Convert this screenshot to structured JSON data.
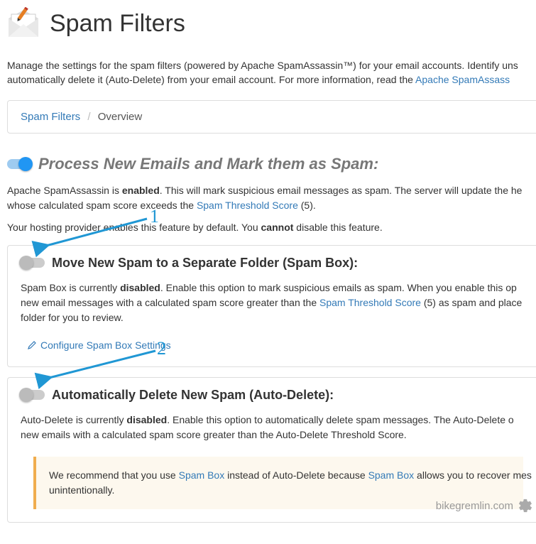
{
  "header": {
    "title": "Spam Filters"
  },
  "intro": {
    "text_a": "Manage the settings for the spam filters (powered by Apache SpamAssassin™) for your email accounts. Identify uns",
    "text_b": "automatically delete it (Auto-Delete) from your email account. For more information, read the ",
    "link": "Apache SpamAssass"
  },
  "breadcrumb": {
    "root": "Spam Filters",
    "current": "Overview"
  },
  "section_process": {
    "title": "Process New Emails and Mark them as Spam:",
    "body_a": "Apache SpamAssassin is ",
    "body_strong": "enabled",
    "body_b": ". This will mark suspicious email messages as spam. The server will update the he",
    "body_c": "whose calculated spam score exceeds the ",
    "link": "Spam Threshold Score",
    "body_d": " (5).",
    "note_a": "Your hosting provider enables this feature by default. You ",
    "note_strong": "cannot",
    "note_b": " disable this feature."
  },
  "section_spambox": {
    "title": "Move New Spam to a Separate Folder (Spam Box):",
    "body_a": "Spam Box is currently ",
    "body_strong": "disabled",
    "body_b": ". Enable this option to mark suspicious emails as spam. When you enable this op",
    "body_c": "new email messages with a calculated spam score greater than the ",
    "link": "Spam Threshold Score",
    "body_d": " (5) as spam and place",
    "body_e": "folder for you to review.",
    "configure": "Configure Spam Box Settings"
  },
  "section_autodelete": {
    "title": "Automatically Delete New Spam (Auto-Delete):",
    "body_a": "Auto-Delete is currently ",
    "body_strong": "disabled",
    "body_b": ". Enable this option to automatically delete spam messages. The Auto-Delete o",
    "body_c": "new emails with a calculated spam score greater than the Auto-Delete Threshold Score.",
    "callout_a": "We recommend that you use ",
    "callout_link1": "Spam Box",
    "callout_b": " instead of Auto-Delete because ",
    "callout_link2": "Spam Box",
    "callout_c": " allows you to recover mes",
    "callout_d": "unintentionally."
  },
  "annotations": {
    "num1": "1",
    "num2": "2"
  },
  "watermark": {
    "text": "bikegremlin.com"
  }
}
